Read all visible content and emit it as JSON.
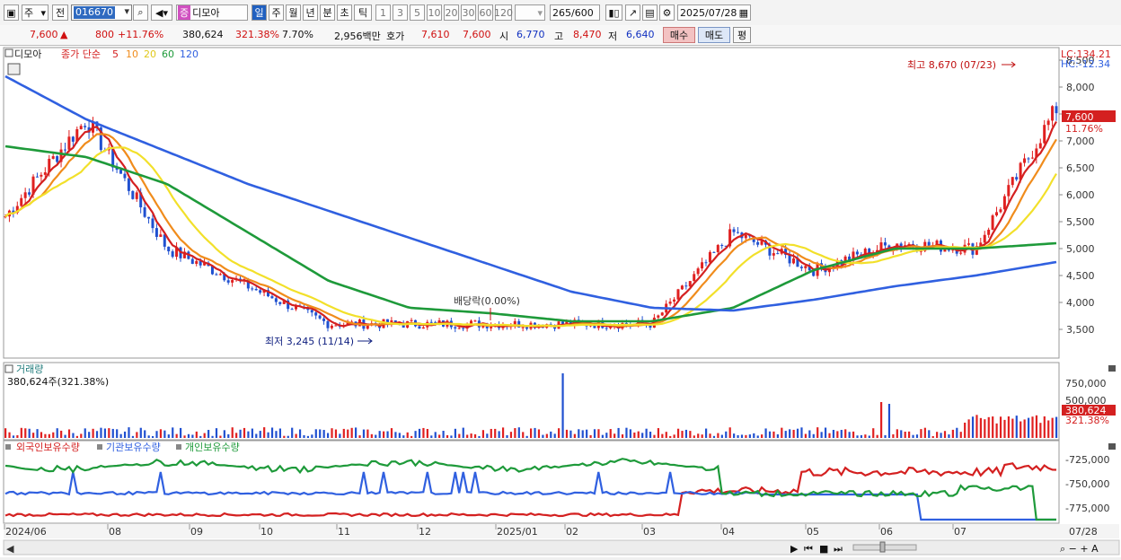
{
  "toolbar": {
    "type_label": "주",
    "market_label": "전",
    "code": "016670",
    "stock_tag": "증",
    "stock_name": "디모아",
    "periods": [
      "일",
      "주",
      "월",
      "년",
      "분",
      "초",
      "틱"
    ],
    "active_period": "일",
    "intervals": [
      "1",
      "3",
      "5",
      "10",
      "20",
      "30",
      "60",
      "120"
    ],
    "count": "265",
    "count_max": "/600",
    "date": "2025/07/28"
  },
  "quote": {
    "price": "7,600",
    "change": "800",
    "change_pct": "+11.76%",
    "volume": "380,624",
    "volume_ratio": "321.38%",
    "turnover": "7.70%",
    "amount": "2,956백만",
    "bid_label": "호가",
    "bid": "7,610",
    "ask": "7,600",
    "open_label": "시",
    "open": "6,770",
    "high_label": "고",
    "high": "8,470",
    "low_label": "저",
    "low": "6,640",
    "buy_label": "매수",
    "sell_label": "매도",
    "avg_label": "평"
  },
  "chart": {
    "title": "디모아",
    "ma_prefix": "종가 단순",
    "ma_periods": [
      "5",
      "10",
      "20",
      "60",
      "120"
    ],
    "ma_colors": [
      "#d42020",
      "#f08c1c",
      "#f2e02a",
      "#1e9a3a",
      "#3060e0"
    ],
    "lc": "LC:134.21",
    "hc": "HC:-12.34",
    "price_ticks": [
      "8,500",
      "8,000",
      "7,500",
      "7,000",
      "6,500",
      "6,000",
      "5,500",
      "5,000",
      "4,500",
      "4,000",
      "3,500"
    ],
    "current_price_tag": "7,600",
    "current_pct_tag": "11.76%",
    "high_note": "최고 8,670 (07/23)",
    "low_note": "최저 3,245 (11/14)",
    "dividend_note": "배당락(0.00%)",
    "volume_title": "거래량",
    "volume_value": "380,624주(321.38%)",
    "volume_ticks": [
      "750,000",
      "500,000"
    ],
    "volume_tag": "380,624",
    "volume_pct_tag": "321.38%",
    "holdings_labels": [
      "외국인보유수량",
      "기관보유수량",
      "개인보유수량"
    ],
    "holdings_colors": [
      "#d42020",
      "#3060e0",
      "#1e9a3a"
    ],
    "holdings_ticks": [
      "-725,000",
      "-750,000",
      "-775,000"
    ],
    "date_labels": [
      "2024/06",
      "08",
      "09",
      "10",
      "11",
      "12",
      "2025/01",
      "02",
      "03",
      "04",
      "05",
      "06",
      "07"
    ],
    "last_date": "07/28"
  },
  "chart_data": {
    "type": "line",
    "title": "디모아",
    "xlabel": "",
    "ylabel": "",
    "ylim": [
      3000,
      8700
    ],
    "x": [
      "2024/06",
      "08",
      "09",
      "10",
      "11",
      "12",
      "2025/01",
      "02",
      "03",
      "04",
      "05",
      "06",
      "07",
      "07/28"
    ],
    "series": [
      {
        "name": "종가",
        "values": [
          5600,
          7400,
          5000,
          4300,
          3600,
          3600,
          3600,
          3600,
          3600,
          5300,
          4600,
          5100,
          5000,
          7600
        ]
      },
      {
        "name": "60",
        "values": [
          6900,
          6700,
          6200,
          5300,
          4400,
          3900,
          3800,
          3650,
          3650,
          3900,
          4600,
          5000,
          5000,
          5100
        ]
      },
      {
        "name": "120",
        "values": [
          8200,
          7400,
          6800,
          6200,
          5700,
          5200,
          4700,
          4200,
          3900,
          3850,
          4050,
          4300,
          4500,
          4750
        ]
      }
    ],
    "annotations": [
      "최고 8,670 (07/23)",
      "최저 3,245 (11/14)",
      "배당락(0.00%)"
    ]
  }
}
